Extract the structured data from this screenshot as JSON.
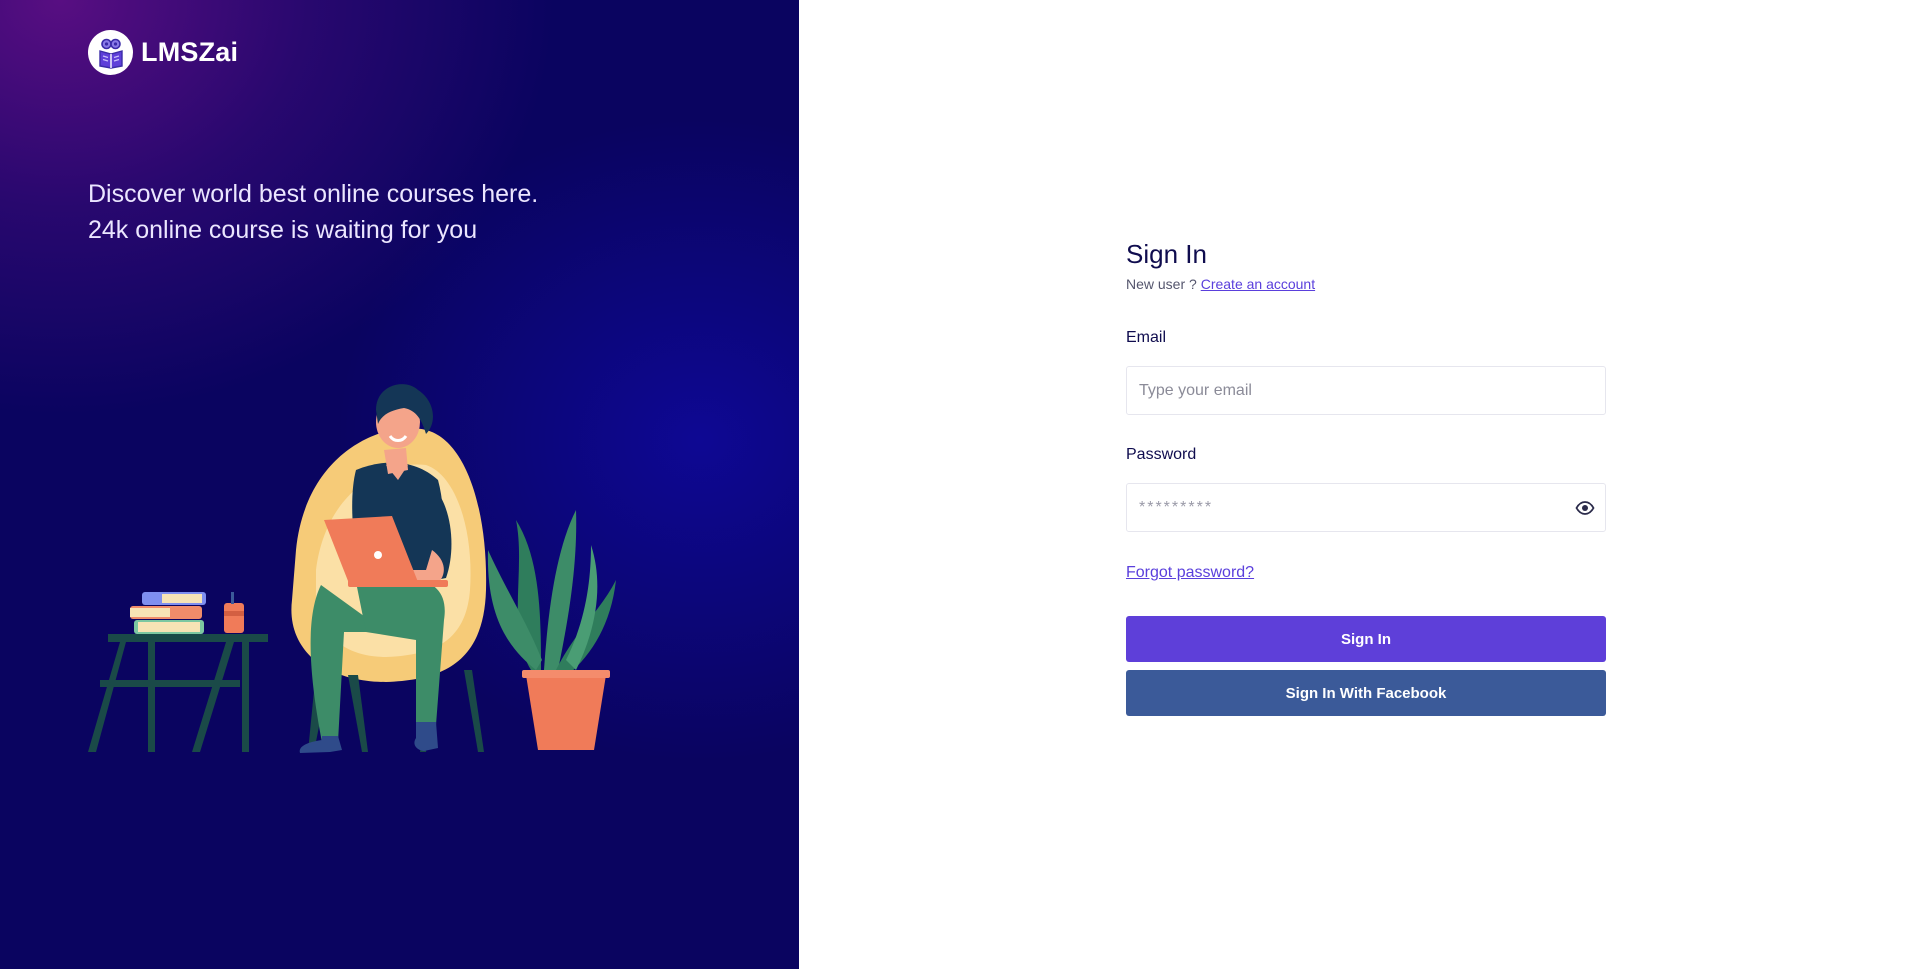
{
  "brand": {
    "name": "LMSZai"
  },
  "hero": {
    "line1": "Discover world best online courses here.",
    "line2": "24k online course is waiting for you"
  },
  "signin": {
    "title": "Sign In",
    "new_user_text": "New user ?",
    "create_account_link": "Create an account",
    "email_label": "Email",
    "email_placeholder": "Type your email",
    "email_value": "",
    "password_label": "Password",
    "password_placeholder": "*********",
    "password_value": "",
    "forgot_link": "Forgot password?",
    "signin_button": "Sign In",
    "facebook_button": "Sign In With Facebook"
  },
  "icons": {
    "logo": "book-reader-logo-icon",
    "password_toggle": "eye-icon"
  },
  "colors": {
    "primary": "#5e3fd9",
    "facebook": "#3b5a99",
    "heading": "#0f0c4e",
    "panel_dark": "#0a0460"
  }
}
